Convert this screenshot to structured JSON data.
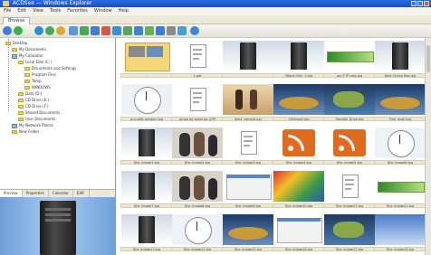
{
  "window": {
    "title": "ACDSee — Windows Explorer"
  },
  "menu": [
    "File",
    "Edit",
    "View",
    "Tools",
    "Favorites",
    "Window",
    "Help"
  ],
  "tabs": {
    "active": "Browse"
  },
  "tree": [
    {
      "label": "Desktop",
      "indent": 0,
      "icon": "folder"
    },
    {
      "label": "My Documents",
      "indent": 1,
      "icon": "folder"
    },
    {
      "label": "My Computer",
      "indent": 1,
      "icon": "pc"
    },
    {
      "label": "Local Disk (C:)",
      "indent": 2,
      "icon": "folder"
    },
    {
      "label": "Documents and Settings",
      "indent": 3,
      "icon": "folder"
    },
    {
      "label": "Program Files",
      "indent": 3,
      "icon": "folder"
    },
    {
      "label": "Temp",
      "indent": 3,
      "icon": "folder"
    },
    {
      "label": "WINDOWS",
      "indent": 3,
      "icon": "folder"
    },
    {
      "label": "Data (D:)",
      "indent": 2,
      "icon": "folder"
    },
    {
      "label": "CD Drive (E:)",
      "indent": 2,
      "icon": "folder"
    },
    {
      "label": "CD Drive (F:)",
      "indent": 2,
      "icon": "folder"
    },
    {
      "label": "Shared Documents",
      "indent": 2,
      "icon": "folder"
    },
    {
      "label": "User Documents",
      "indent": 2,
      "icon": "folder"
    },
    {
      "label": "My Network Places",
      "indent": 1,
      "icon": "pc"
    },
    {
      "label": "New Folder",
      "indent": 1,
      "icon": "folder"
    }
  ],
  "panel_tabs": [
    "Preview",
    "Properties",
    "Calendar",
    "EXIF"
  ],
  "thumbs": [
    {
      "caption": "..",
      "kind": "folder"
    },
    {
      "caption": "1.pdf",
      "kind": "doc"
    },
    {
      "caption": "",
      "kind": "pc"
    },
    {
      "caption": "Miami_Dim_1.jpg",
      "kind": "pc"
    },
    {
      "caption": "acc-FTP-rota.jpg",
      "kind": "banner"
    },
    {
      "caption": "Best Online Box.jpg",
      "kind": "pc"
    },
    {
      "caption": "ar-cutlet-rotation.jpg",
      "kind": "clock"
    },
    {
      "caption": "grupo de alumnos 4.PP",
      "kind": "doc"
    },
    {
      "caption": "alert_camera.jpg",
      "kind": "dancers"
    },
    {
      "caption": "CMjessell.jpg",
      "kind": "earth"
    },
    {
      "caption": "firmdell_Drive.jpg",
      "kind": "earth2"
    },
    {
      "caption": "Fine_pixel.jpg",
      "kind": "earth"
    },
    {
      "caption": "fine_image1.jpg",
      "kind": "pc"
    },
    {
      "caption": "fine_image2.jpg",
      "kind": "people"
    },
    {
      "caption": "fine_image3.jpg",
      "kind": "doc"
    },
    {
      "caption": "fine_image4.jpg",
      "kind": "rss"
    },
    {
      "caption": "fine_image5.jpg",
      "kind": "rss"
    },
    {
      "caption": "fine_image6.jpg",
      "kind": "clock"
    },
    {
      "caption": "fine_image7.jpg",
      "kind": "pc"
    },
    {
      "caption": "fine_image8.jpg",
      "kind": "people"
    },
    {
      "caption": "fine_image9.jpg",
      "kind": "dialog"
    },
    {
      "caption": "fine_image10.jpg",
      "kind": "colorful"
    },
    {
      "caption": "fine_image11.jpg",
      "kind": "doc"
    },
    {
      "caption": "fine_image12.jpg",
      "kind": "banner"
    },
    {
      "caption": "fine_image13.jpg",
      "kind": "pc"
    },
    {
      "caption": "fine_image14.jpg",
      "kind": "clock"
    },
    {
      "caption": "fine_image15.jpg",
      "kind": "earth"
    },
    {
      "caption": "fine_image16.jpg",
      "kind": "dialog"
    },
    {
      "caption": "fine_image17.jpg",
      "kind": "earth2"
    },
    {
      "caption": "fine_image18.jpg",
      "kind": "sky"
    }
  ]
}
